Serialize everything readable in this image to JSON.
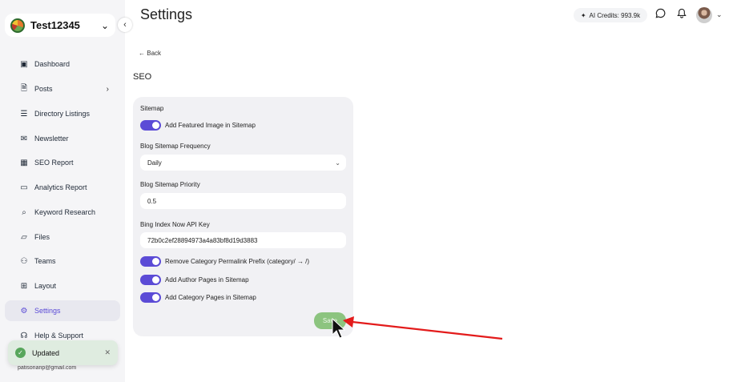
{
  "workspace": {
    "name": "Test12345"
  },
  "sidebar": {
    "items": [
      {
        "label": "Dashboard",
        "icon": "dashboard-icon",
        "glyph": "▣"
      },
      {
        "label": "Posts",
        "icon": "posts-icon",
        "glyph": "🗎",
        "has_submenu": true
      },
      {
        "label": "Directory Listings",
        "icon": "directory-icon",
        "glyph": "☰"
      },
      {
        "label": "Newsletter",
        "icon": "mail-icon",
        "glyph": "✉"
      },
      {
        "label": "SEO Report",
        "icon": "report-icon",
        "glyph": "▦"
      },
      {
        "label": "Analytics Report",
        "icon": "analytics-icon",
        "glyph": "▭"
      },
      {
        "label": "Keyword Research",
        "icon": "keyword-icon",
        "glyph": "⌕"
      },
      {
        "label": "Files",
        "icon": "folder-icon",
        "glyph": "▱"
      },
      {
        "label": "Teams",
        "icon": "team-icon",
        "glyph": "⚇"
      },
      {
        "label": "Layout",
        "icon": "layout-icon",
        "glyph": "⊞"
      },
      {
        "label": "Settings",
        "icon": "gear-icon",
        "glyph": "⚙",
        "active": true
      },
      {
        "label": "Help & Support",
        "icon": "headset-icon",
        "glyph": "☊"
      }
    ],
    "user_email": "patisonanp@gmail.com"
  },
  "toast": {
    "text": "Updated"
  },
  "header": {
    "title": "Settings",
    "credits": "AI Credits: 993.9k"
  },
  "main": {
    "back_label": "Back",
    "section_title": "SEO",
    "sitemap_label": "Sitemap",
    "featured_image_toggle": "Add Featured Image in Sitemap",
    "frequency_label": "Blog Sitemap Frequency",
    "frequency_value": "Daily",
    "priority_label": "Blog Sitemap Priority",
    "priority_value": "0.5",
    "bing_label": "Bing Index Now API Key",
    "bing_value": "72b0c2ef28894973a4a83bf8d19d3883",
    "toggles": [
      "Remove Category Permalink Prefix (category/ → /)",
      "Add Author Pages in Sitemap",
      "Add Category Pages in Sitemap"
    ],
    "save_label": "Save"
  },
  "colors": {
    "accent": "#5b4bd6",
    "save": "#8cc47f",
    "annotation_arrow": "#e31b1b"
  }
}
